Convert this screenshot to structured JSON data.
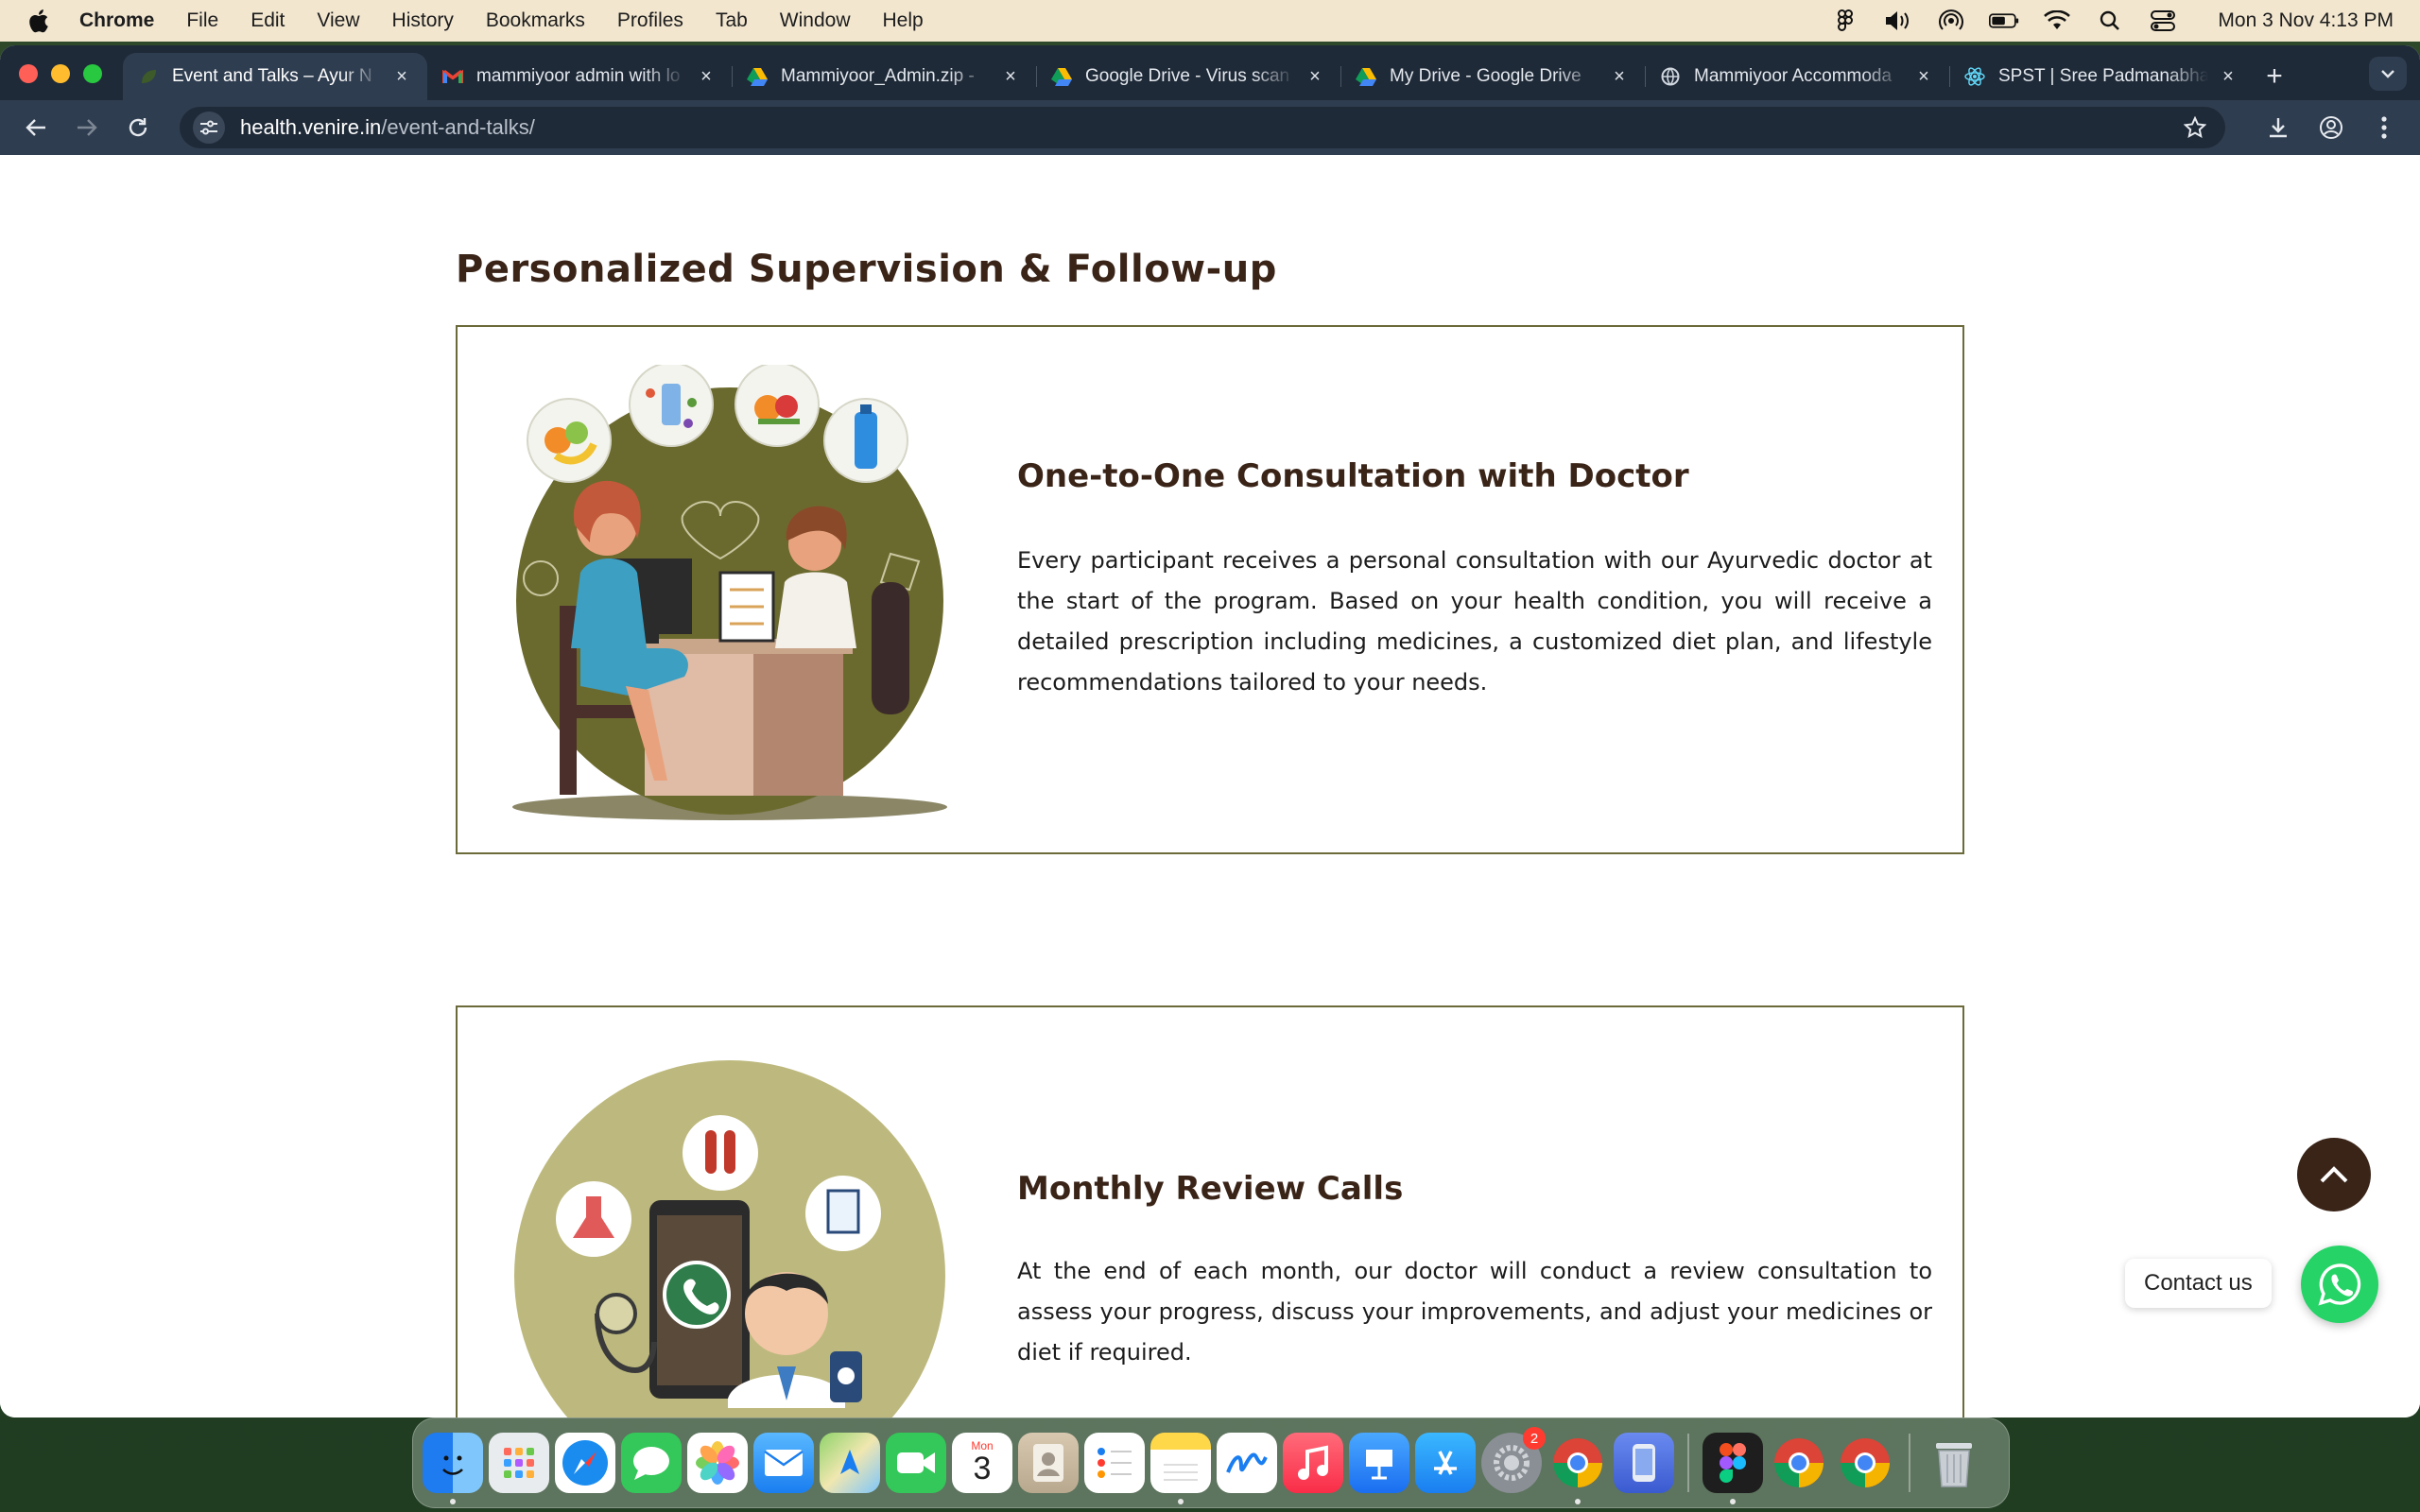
{
  "menubar": {
    "app": "Chrome",
    "items": [
      "File",
      "Edit",
      "View",
      "History",
      "Bookmarks",
      "Profiles",
      "Tab",
      "Window",
      "Help"
    ],
    "clock": "Mon 3 Nov  4:13 PM"
  },
  "tabs": [
    {
      "title": "Event and Talks – Ayur N",
      "icon": "leaf-favicon-icon",
      "active": true
    },
    {
      "title": "mammiyoor admin with lo",
      "icon": "gmail-icon",
      "active": false
    },
    {
      "title": "Mammiyoor_Admin.zip -",
      "icon": "google-drive-icon",
      "active": false
    },
    {
      "title": "Google Drive - Virus scan",
      "icon": "google-drive-icon",
      "active": false
    },
    {
      "title": "My Drive - Google Drive",
      "icon": "google-drive-icon",
      "active": false
    },
    {
      "title": "Mammiyoor Accommoda",
      "icon": "globe-icon",
      "active": false
    },
    {
      "title": "SPST | Sree Padmanabha",
      "icon": "react-icon",
      "active": false
    }
  ],
  "address": {
    "domain": "health.venire.in",
    "path": "/event-and-talks/"
  },
  "page": {
    "section_title": "Personalized Supervision & Follow-up",
    "cards": [
      {
        "heading": "One-to-One Consultation with Doctor",
        "body": "Every participant receives a personal consultation with our Ayurvedic doctor at the start of the program. Based on your health condition, you will receive a detailed prescription including medicines, a customized diet plan, and lifestyle recommendations tailored to your needs."
      },
      {
        "heading": "Monthly Review Calls",
        "body": "At the end of each month, our doctor will conduct a review consultation to assess your progress, discuss your improvements, and adjust your medicines or diet if required."
      }
    ],
    "contact_label": "Contact us"
  },
  "dock": {
    "calendar_month": "Mon",
    "calendar_day": "3",
    "settings_badge": "2"
  },
  "colors": {
    "heading": "#3a2418",
    "card_border": "#6b6a3a",
    "olive_circle": "#6b6a2e",
    "khaki_circle": "#bdb97e",
    "whatsapp": "#25d366"
  }
}
